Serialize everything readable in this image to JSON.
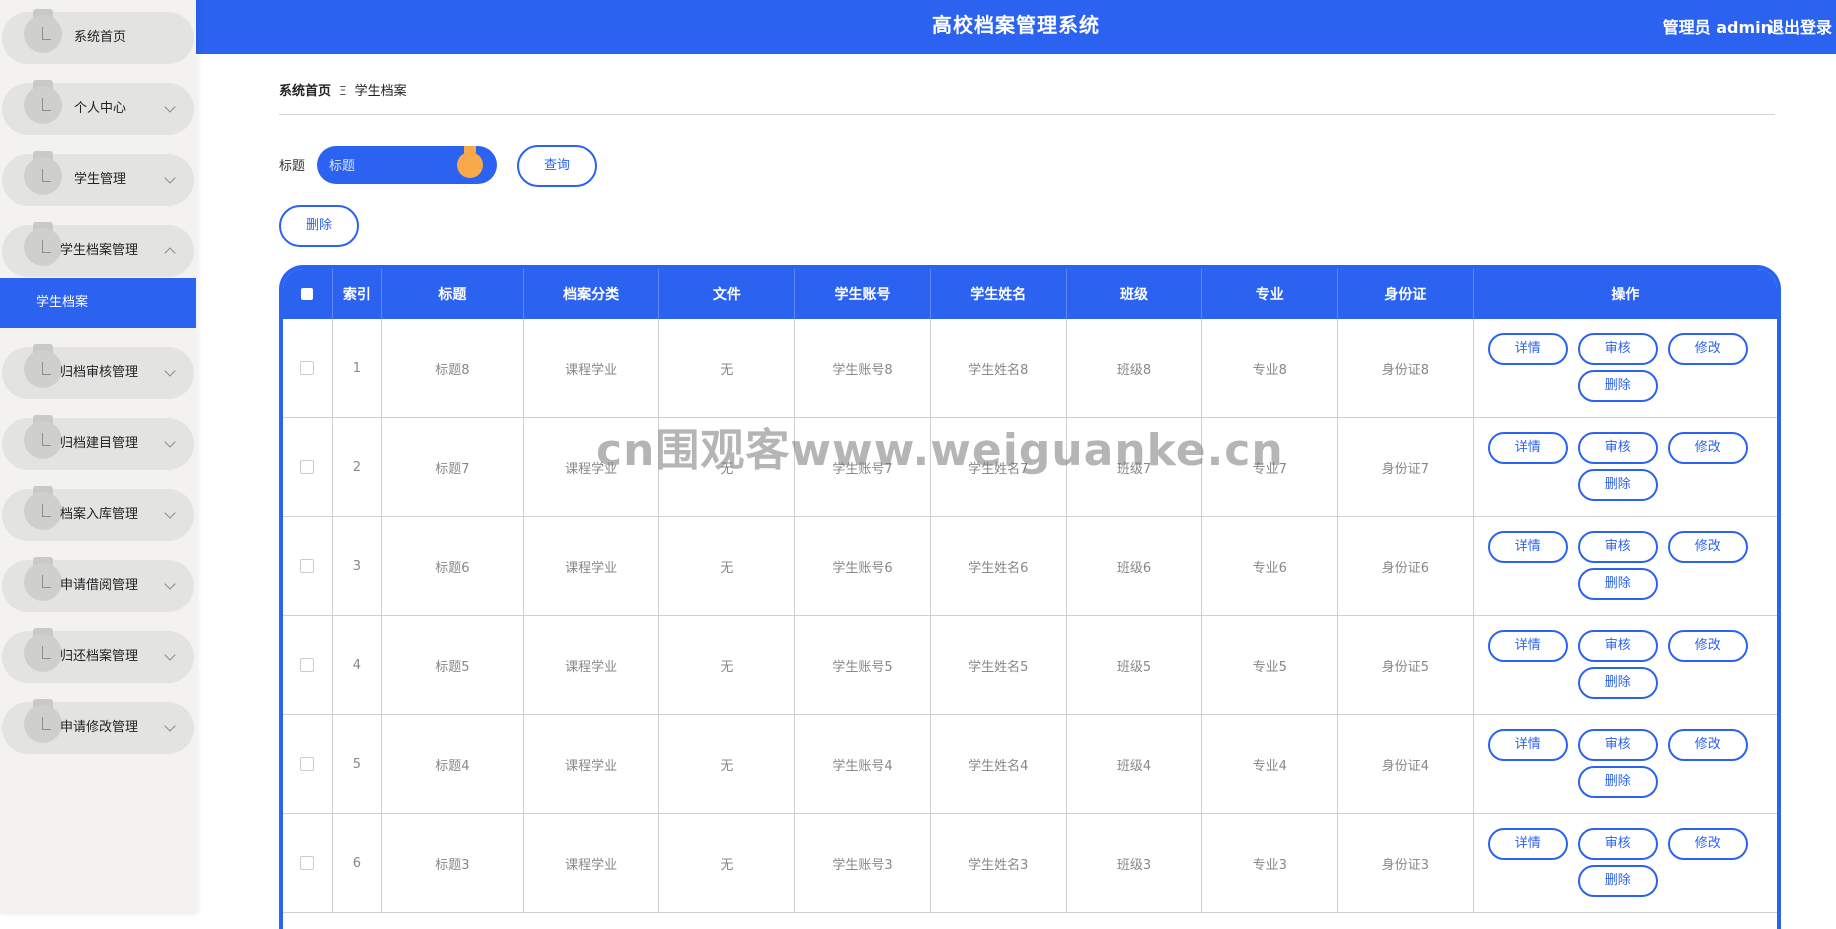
{
  "header": {
    "title": "高校档案管理系统",
    "user": "管理员 admin",
    "logout": "退出登录",
    "accent_color": "#2b62f0"
  },
  "sidebar": {
    "items": [
      {
        "label": "系统首页",
        "icon": "pin-icon",
        "expandable": false
      },
      {
        "label": "个人中心",
        "icon": "pin-icon",
        "expandable": true
      },
      {
        "label": "学生管理",
        "icon": "pin-icon",
        "expandable": true
      },
      {
        "label": "学生档案管理",
        "icon": "pin-icon",
        "expandable": true,
        "expanded": true
      },
      {
        "label": "归档审核管理",
        "icon": "pin-icon",
        "expandable": true
      },
      {
        "label": "归档建目管理",
        "icon": "pin-icon",
        "expandable": true
      },
      {
        "label": "档案入库管理",
        "icon": "pin-icon",
        "expandable": true
      },
      {
        "label": "申请借阅管理",
        "icon": "pin-icon",
        "expandable": true
      },
      {
        "label": "归还档案管理",
        "icon": "pin-icon",
        "expandable": true
      },
      {
        "label": "申请修改管理",
        "icon": "pin-icon",
        "expandable": true
      }
    ],
    "active_subitem": "学生档案"
  },
  "breadcrumb": {
    "home": "系统首页",
    "separator": "Ξ",
    "current": "学生档案"
  },
  "search": {
    "label": "标题",
    "placeholder": "标题",
    "query_button": "查询"
  },
  "toolbar": {
    "delete_button": "删除"
  },
  "table": {
    "columns": [
      "",
      "索引",
      "标题",
      "档案分类",
      "文件",
      "学生账号",
      "学生姓名",
      "班级",
      "专业",
      "身份证",
      "操作"
    ],
    "rows": [
      {
        "index": "1",
        "title": "标题8",
        "category": "课程学业",
        "file": "无",
        "account": "学生账号8",
        "name": "学生姓名8",
        "class": "班级8",
        "major": "专业8",
        "id_card": "身份证8"
      },
      {
        "index": "2",
        "title": "标题7",
        "category": "课程学业",
        "file": "无",
        "account": "学生账号7",
        "name": "学生姓名7",
        "class": "班级7",
        "major": "专业7",
        "id_card": "身份证7"
      },
      {
        "index": "3",
        "title": "标题6",
        "category": "课程学业",
        "file": "无",
        "account": "学生账号6",
        "name": "学生姓名6",
        "class": "班级6",
        "major": "专业6",
        "id_card": "身份证6"
      },
      {
        "index": "4",
        "title": "标题5",
        "category": "课程学业",
        "file": "无",
        "account": "学生账号5",
        "name": "学生姓名5",
        "class": "班级5",
        "major": "专业5",
        "id_card": "身份证5"
      },
      {
        "index": "5",
        "title": "标题4",
        "category": "课程学业",
        "file": "无",
        "account": "学生账号4",
        "name": "学生姓名4",
        "class": "班级4",
        "major": "专业4",
        "id_card": "身份证4"
      },
      {
        "index": "6",
        "title": "标题3",
        "category": "课程学业",
        "file": "无",
        "account": "学生账号3",
        "name": "学生姓名3",
        "class": "班级3",
        "major": "专业3",
        "id_card": "身份证3"
      }
    ],
    "row_actions": {
      "detail": "详情",
      "review": "审核",
      "edit": "修改",
      "delete": "删除"
    }
  },
  "watermark": "cn围观客www.weiguanke.cn"
}
